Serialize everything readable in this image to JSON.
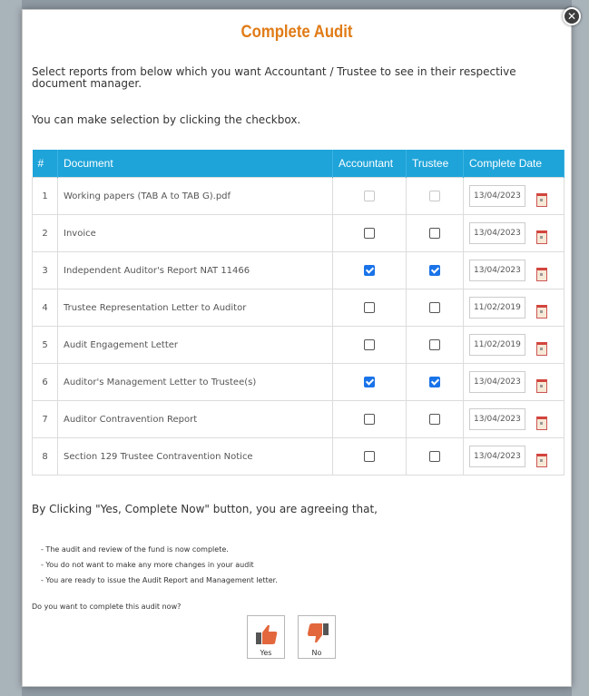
{
  "modal": {
    "title": "Complete Audit",
    "close_glyph": "✕",
    "intro": "Select reports from below which you want Accountant / Trustee to see in their respective document manager.",
    "hint": "You can make selection by clicking the checkbox.",
    "table": {
      "headers": [
        "#",
        "Document",
        "Accountant",
        "Trustee",
        "Complete Date"
      ],
      "rows": [
        {
          "num": "1",
          "doc": "Working papers (TAB A to TAB G).pdf",
          "accountant": "disabled",
          "trustee": "disabled",
          "date": "13/04/2023"
        },
        {
          "num": "2",
          "doc": "Invoice",
          "accountant": "unchecked",
          "trustee": "unchecked",
          "date": "13/04/2023"
        },
        {
          "num": "3",
          "doc": "Independent Auditor's Report NAT 11466",
          "accountant": "checked",
          "trustee": "checked",
          "date": "13/04/2023"
        },
        {
          "num": "4",
          "doc": "Trustee Representation Letter to Auditor",
          "accountant": "unchecked",
          "trustee": "unchecked",
          "date": "11/02/2019"
        },
        {
          "num": "5",
          "doc": "Audit Engagement Letter",
          "accountant": "unchecked",
          "trustee": "unchecked",
          "date": "11/02/2019"
        },
        {
          "num": "6",
          "doc": "Auditor's Management Letter to Trustee(s)",
          "accountant": "checked",
          "trustee": "checked",
          "date": "13/04/2023"
        },
        {
          "num": "7",
          "doc": "Auditor Contravention Report",
          "accountant": "unchecked",
          "trustee": "unchecked",
          "date": "13/04/2023"
        },
        {
          "num": "8",
          "doc": "Section 129 Trustee Contravention Notice",
          "accountant": "unchecked",
          "trustee": "unchecked",
          "date": "13/04/2023"
        }
      ]
    },
    "agree_text": "By Clicking \"Yes, Complete Now\" button, you are agreeing that,",
    "bullets": [
      "- The audit and review of the fund is now complete.",
      "- You do not want to make any more changes in your audit",
      "- You are ready to issue the Audit Report and Management letter."
    ],
    "question": "Do you want to complete this audit now?",
    "yes_label": "Yes",
    "no_label": "No"
  },
  "colors": {
    "title": "#e07b16",
    "table_header": "#1ea4d9",
    "checkbox_checked": "#1a73e8",
    "thumb": "#e2673c"
  },
  "icons": {
    "close": "close-icon",
    "calendar": "calendar-icon",
    "yes": "thumbs-up-icon",
    "no": "thumbs-down-icon"
  }
}
